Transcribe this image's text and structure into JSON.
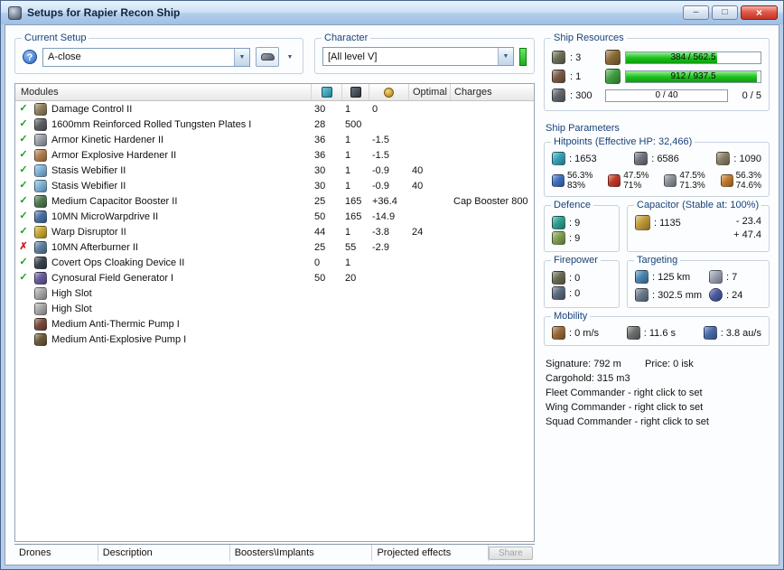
{
  "icons": {
    "help": "?",
    "dropdown": "▼",
    "fitted_check": "✓",
    "offline_x": "✗",
    "minimize": "–",
    "maximize": "□",
    "close": "×"
  },
  "window": {
    "title": "Setups for Rapier Recon Ship"
  },
  "setup": {
    "group_label": "Current Setup",
    "selected": "A-close"
  },
  "character": {
    "group_label": "Character",
    "selected": "[All level V]"
  },
  "resources": {
    "group_label": "Ship Resources",
    "turret_hardpoints": ": 3",
    "launcher_hardpoints": ": 1",
    "calibration": ": 300",
    "powergrid_bar": {
      "text": "384 / 562.5",
      "pct": 68
    },
    "cpu_bar": {
      "text": "912 / 937.5",
      "pct": 97
    },
    "dronebay_bar": {
      "text": "0 / 40",
      "pct": 0
    },
    "drones": "0 / 5"
  },
  "modules": {
    "header": {
      "name": "Modules",
      "optimal": "Optimal",
      "charges": "Charges"
    },
    "rows": [
      {
        "status": "ok",
        "icon_name": "damage-control-icon",
        "icon": "#8f7f5c",
        "name": "Damage Control II",
        "cpu": "30",
        "pg": "1",
        "cap": "0",
        "optimal": "",
        "charges": ""
      },
      {
        "status": "ok",
        "icon_name": "armor-plate-icon",
        "icon": "#5c6066",
        "name": "1600mm Reinforced Rolled Tungsten Plates I",
        "cpu": "28",
        "pg": "500",
        "cap": "",
        "optimal": "",
        "charges": ""
      },
      {
        "status": "ok",
        "icon_name": "kinetic-hardener-icon",
        "icon": "#9aa0a8",
        "name": "Armor Kinetic Hardener II",
        "cpu": "36",
        "pg": "1",
        "cap": "-1.5",
        "optimal": "",
        "charges": ""
      },
      {
        "status": "ok",
        "icon_name": "explosive-hardener-icon",
        "icon": "#b0804e",
        "name": "Armor Explosive Hardener II",
        "cpu": "36",
        "pg": "1",
        "cap": "-1.5",
        "optimal": "",
        "charges": ""
      },
      {
        "status": "ok",
        "icon_name": "stasis-webifier-icon",
        "icon": "#7fb2d9",
        "name": "Stasis Webifier II",
        "cpu": "30",
        "pg": "1",
        "cap": "-0.9",
        "optimal": "40",
        "charges": ""
      },
      {
        "status": "ok",
        "icon_name": "stasis-webifier-icon",
        "icon": "#7fb2d9",
        "name": "Stasis Webifier II",
        "cpu": "30",
        "pg": "1",
        "cap": "-0.9",
        "optimal": "40",
        "charges": ""
      },
      {
        "status": "ok",
        "icon_name": "capacitor-booster-icon",
        "icon": "#4f7a50",
        "name": "Medium Capacitor Booster II",
        "cpu": "25",
        "pg": "165",
        "cap": "+36.4",
        "optimal": "",
        "charges": "Cap Booster 800"
      },
      {
        "status": "ok",
        "icon_name": "microwarpdrive-icon",
        "icon": "#4a6fa5",
        "name": "10MN MicroWarpdrive II",
        "cpu": "50",
        "pg": "165",
        "cap": "-14.9",
        "optimal": "",
        "charges": ""
      },
      {
        "status": "ok",
        "icon_name": "warp-disruptor-icon",
        "icon": "#c8a830",
        "name": "Warp Disruptor II",
        "cpu": "44",
        "pg": "1",
        "cap": "-3.8",
        "optimal": "24",
        "charges": ""
      },
      {
        "status": "offline",
        "icon_name": "afterburner-icon",
        "icon": "#5f7fa0",
        "name": "10MN Afterburner II",
        "cpu": "25",
        "pg": "55",
        "cap": "-2.9",
        "optimal": "",
        "charges": ""
      },
      {
        "status": "ok",
        "icon_name": "cloaking-device-icon",
        "icon": "#3c4350",
        "name": "Covert Ops Cloaking Device II",
        "cpu": "0",
        "pg": "1",
        "cap": "",
        "optimal": "",
        "charges": ""
      },
      {
        "status": "ok",
        "icon_name": "cyno-generator-icon",
        "icon": "#6a5a9a",
        "name": "Cynosural Field Generator I",
        "cpu": "50",
        "pg": "20",
        "cap": "",
        "optimal": "",
        "charges": ""
      },
      {
        "status": "empty",
        "icon_name": "empty-highslot-icon",
        "icon": "#a8a8a8",
        "name": "High Slot",
        "cpu": "",
        "pg": "",
        "cap": "",
        "optimal": "",
        "charges": ""
      },
      {
        "status": "empty",
        "icon_name": "empty-highslot-icon",
        "icon": "#a8a8a8",
        "name": "High Slot",
        "cpu": "",
        "pg": "",
        "cap": "",
        "optimal": "",
        "charges": ""
      },
      {
        "status": "rig",
        "icon_name": "anti-thermic-pump-icon",
        "icon": "#7a4a3c",
        "name": "Medium Anti-Thermic Pump I",
        "cpu": "",
        "pg": "",
        "cap": "",
        "optimal": "",
        "charges": ""
      },
      {
        "status": "rig",
        "icon_name": "anti-explosive-pump-icon",
        "icon": "#6d5a38",
        "name": "Medium Anti-Explosive Pump I",
        "cpu": "",
        "pg": "",
        "cap": "",
        "optimal": "",
        "charges": ""
      }
    ]
  },
  "parameters": {
    "group_label": "Ship Parameters",
    "hitpoints": {
      "label": "Hitpoints (Effective HP: 32,466)",
      "shield": ": 1653",
      "armor": ": 6586",
      "structure": ": 1090",
      "resists": [
        {
          "shield_pct": "56.3%",
          "armor_pct": "83%"
        },
        {
          "shield_pct": "47.5%",
          "armor_pct": "71%"
        },
        {
          "shield_pct": "47.5%",
          "armor_pct": "71.3%"
        },
        {
          "shield_pct": "56.3%",
          "armor_pct": "74.6%"
        }
      ]
    },
    "defence": {
      "label": "Defence",
      "shield_value": ": 9",
      "armor_value": ": 9"
    },
    "capacitor": {
      "label": "Capacitor (Stable at: 100%)",
      "amount": ": 1135",
      "usage": "- 23.4",
      "recharge": "+ 47.4"
    },
    "firepower": {
      "label": "Firepower",
      "turret_dps": ": 0",
      "missile_dps": ": 0"
    },
    "targeting": {
      "label": "Targeting",
      "range": ": 125 km",
      "max_targets": ": 7",
      "scan_resolution": ": 302.5 mm",
      "sensor_strength": ": 24"
    },
    "mobility": {
      "label": "Mobility",
      "speed": ": 0 m/s",
      "align_time": ": 11.6 s",
      "warp_speed": ": 3.8 au/s"
    },
    "signature": "Signature: 792 m",
    "price": "Price: 0 isk",
    "cargohold": "Cargohold: 315 m3",
    "fleet_commander": "Fleet Commander - right click to set",
    "wing_commander": "Wing Commander - right click to set",
    "squad_commander": "Squad Commander - right click to set"
  },
  "tabs": {
    "drones": "Drones",
    "description": "Description",
    "boosters": "Boosters\\Implants",
    "projected": "Projected effects",
    "share": "Share"
  }
}
